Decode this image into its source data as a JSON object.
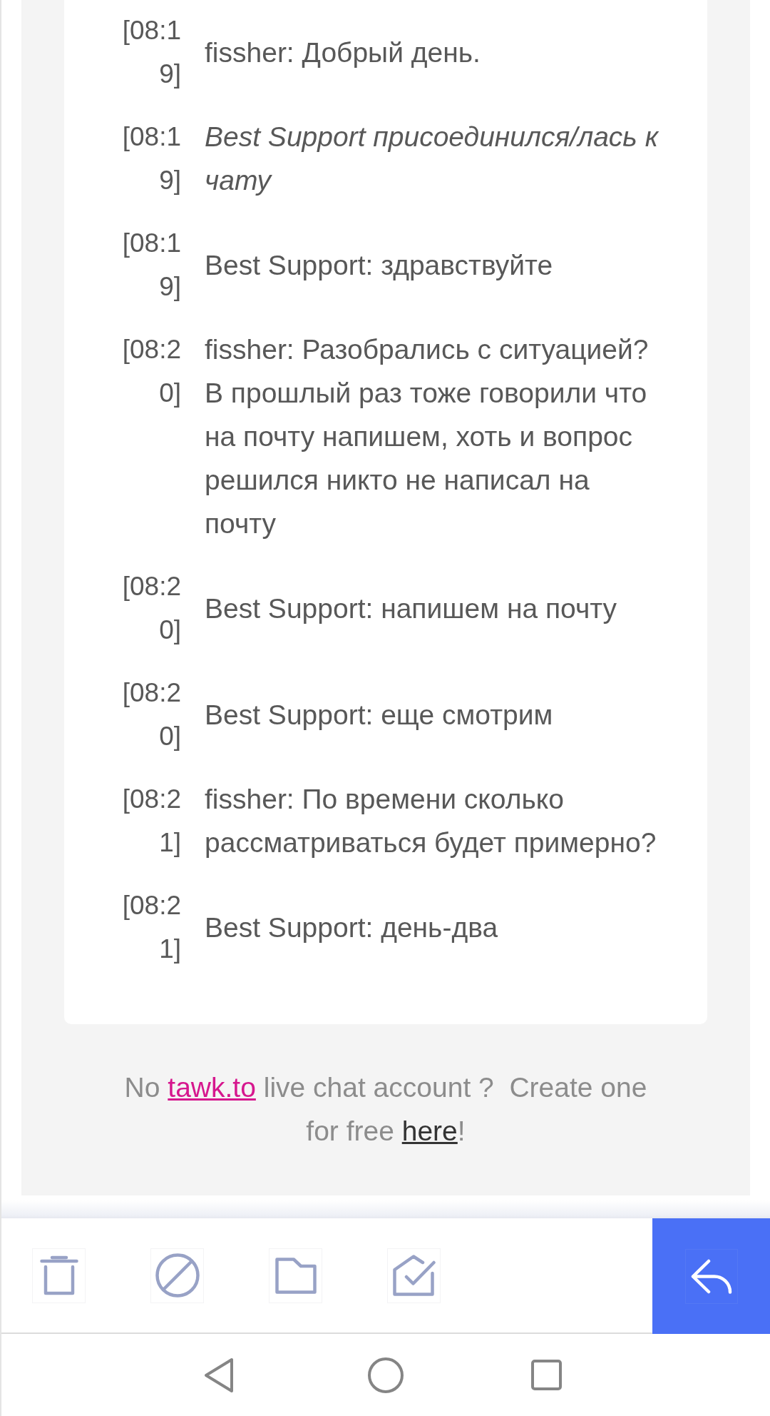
{
  "messages": [
    {
      "time": "[08:19]",
      "kind": "message",
      "text": "fissher: Добрый день."
    },
    {
      "time": "[08:19]",
      "kind": "event",
      "text": "Best Support присоединился/лась к чату"
    },
    {
      "time": "[08:19]",
      "kind": "message",
      "text": "Best Support: здравствуйте"
    },
    {
      "time": "[08:20]",
      "kind": "message",
      "text": "fissher: Разобрались с ситуацией? В прошлый раз тоже говорили что на почту напишем, хоть и вопрос решился никто не написал на почту"
    },
    {
      "time": "[08:20]",
      "kind": "message",
      "text": "Best Support: напишем на почту"
    },
    {
      "time": "[08:20]",
      "kind": "message",
      "text": "Best Support: еще смотрим"
    },
    {
      "time": "[08:21]",
      "kind": "message",
      "text": "fissher: По времени сколько рассматриваться будет примерно?"
    },
    {
      "time": "[08:21]",
      "kind": "message",
      "text": "Best Support: день-два"
    }
  ],
  "footer": {
    "segments": [
      {
        "kind": "text",
        "text": "No "
      },
      {
        "kind": "accent_link",
        "text": "tawk.to"
      },
      {
        "kind": "text",
        "text": " live chat account ?  Create one for free "
      },
      {
        "kind": "link",
        "text": "here"
      },
      {
        "kind": "text",
        "text": "!"
      }
    ]
  }
}
